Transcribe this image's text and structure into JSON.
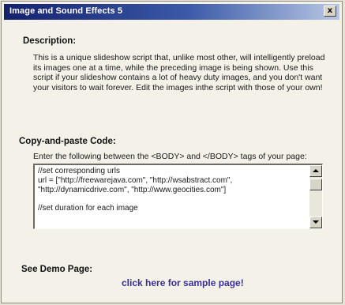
{
  "window": {
    "title": "Image and Sound Effects 5",
    "close_glyph": "x"
  },
  "description": {
    "heading": "Description:",
    "body": "This is a unique slideshow script that, unlike most other, will intelligently preload its images one at a time, while the preceding image is being shown. Use this script if your slideshow contains a lot of heavy duty images, and you don't want your visitors to wait forever. Edit the images inthe script with those of your own!"
  },
  "code_section": {
    "heading": "Copy-and-paste Code:",
    "instruction": "Enter the following between the <BODY> and </BODY> tags of your page:",
    "code": "//set corresponding urls\nurl = [\"http://freewarejava.com\", \"http://wsabstract.com\",\n\"http://dynamicdrive.com\", \"http://www.geocities.com\"]\n\n//set duration for each image"
  },
  "demo": {
    "heading": "See Demo Page:",
    "link_text": "click here for sample page!"
  },
  "icons": {
    "close": "close-icon",
    "scroll_up": "arrow-up-icon",
    "scroll_down": "arrow-down-icon"
  },
  "colors": {
    "titlebar_start": "#14206e",
    "titlebar_end": "#b8c7e4",
    "panel": "#f4f1e8",
    "link": "#3a2f96"
  }
}
